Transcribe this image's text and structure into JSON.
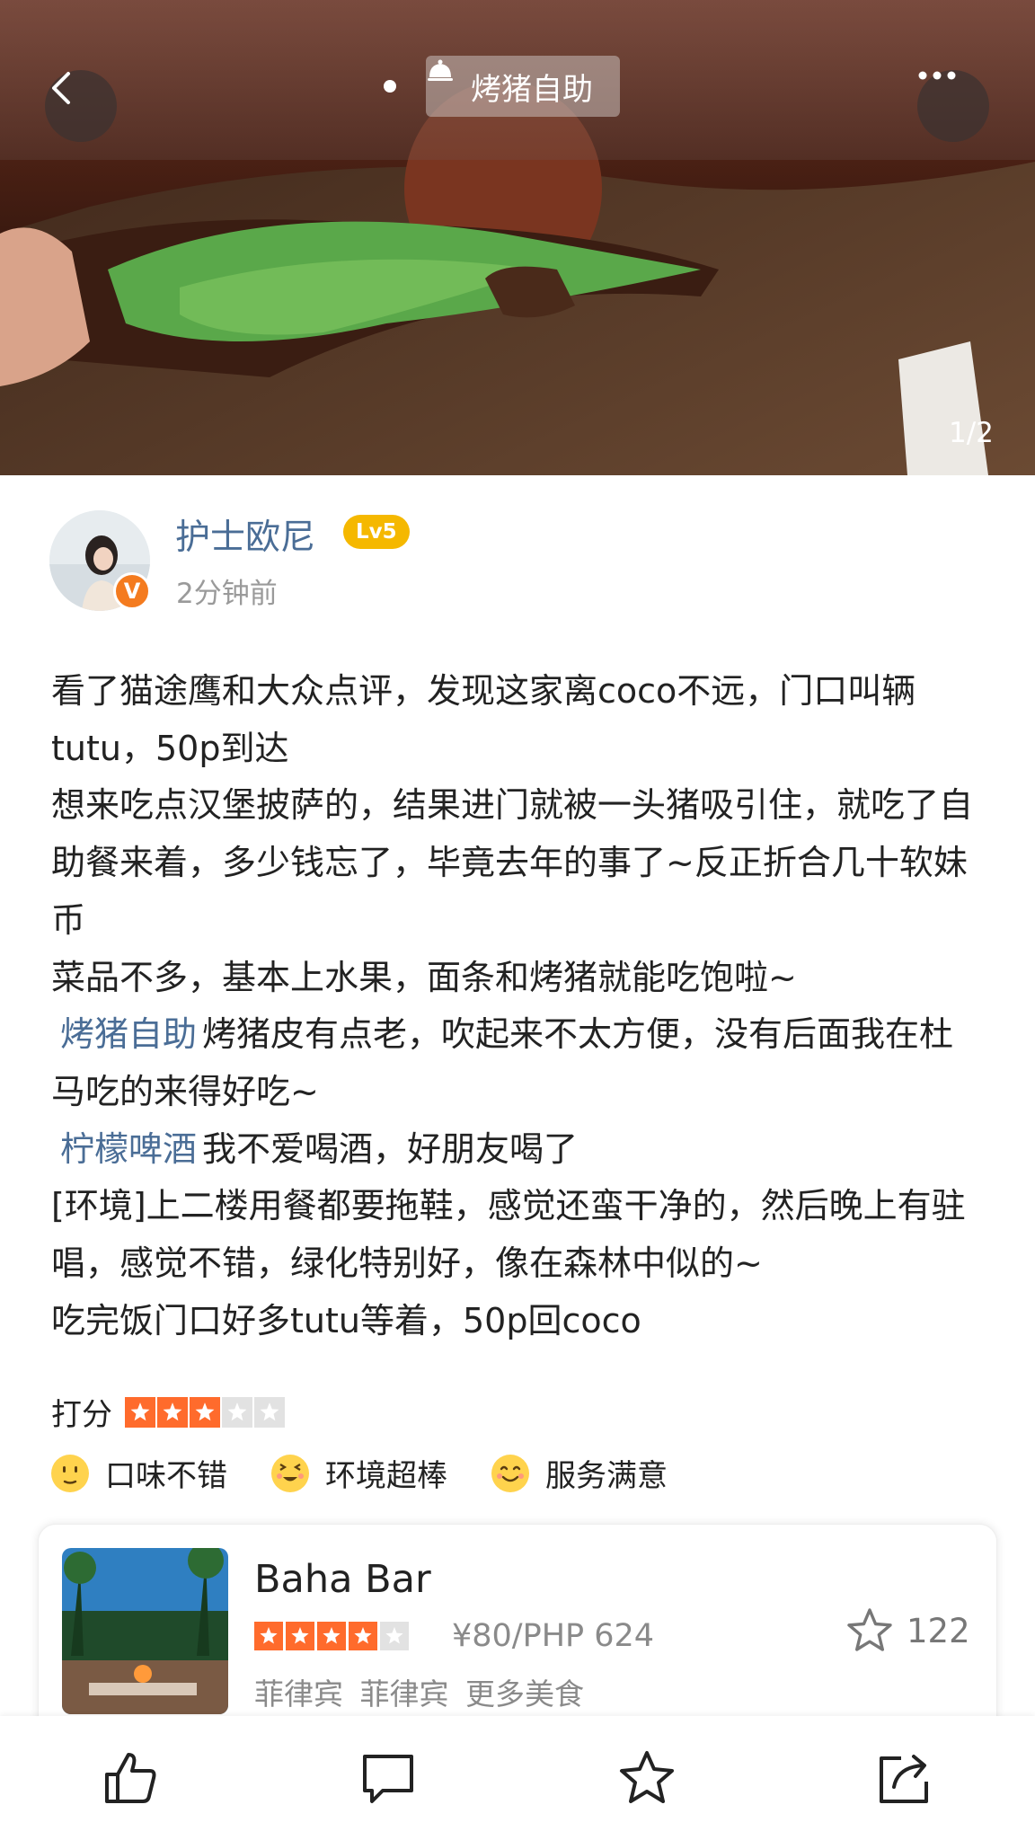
{
  "hero": {
    "tag_label": "烤猪自助",
    "counter": "1/2"
  },
  "author": {
    "name": "护士欧尼",
    "level": "Lv5",
    "time": "2分钟前",
    "verified_mark": "V"
  },
  "review": {
    "line1": "看了猫途鹰和大众点评，发现这家离coco不远，门口叫辆tutu，50p到达",
    "line2": "想来吃点汉堡披萨的，结果进门就被一头猪吸引住，就吃了自助餐来着，多少钱忘了，毕竟去年的事了~反正折合几十软妹币",
    "line3": "菜品不多，基本上水果，面条和烤猪就能吃饱啦~",
    "dish1_tag": "烤猪自助",
    "dish1_text": "烤猪皮有点老，吹起来不太方便，没有后面我在杜马吃的来得好吃~",
    "dish2_tag": "柠檬啤酒",
    "dish2_text": "我不爱喝酒，好朋友喝了",
    "line_env": "[环境]上二楼用餐都要拖鞋，感觉还蛮干净的，然后晚上有驻唱，感觉不错，绿化特别好，像在森林中似的~",
    "line_end": "吃完饭门口好多tutu等着，50p回coco"
  },
  "rating": {
    "label": "打分",
    "score": 3,
    "max": 5
  },
  "moods": [
    {
      "icon": "neutral-face-icon",
      "label": "口味不错"
    },
    {
      "icon": "grin-face-icon",
      "label": "环境超棒"
    },
    {
      "icon": "smile-face-icon",
      "label": "服务满意"
    }
  ],
  "shop": {
    "name": "Baha Bar",
    "stars": 4,
    "stars_max": 5,
    "price": "¥80/PHP 624",
    "meta": "菲律宾 菲律宾 更多美食",
    "fav_count": "122"
  },
  "colors": {
    "accent_link": "#4a6d96",
    "star_on": "#ff6b2c",
    "level_badge": "#f5b800"
  },
  "bottom_bar": [
    "like-icon",
    "comment-icon",
    "favorite-icon",
    "share-icon"
  ]
}
